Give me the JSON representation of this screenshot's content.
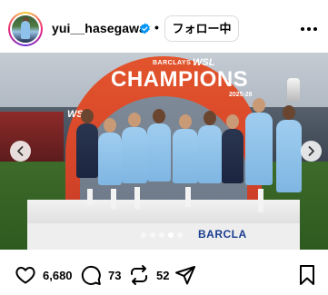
{
  "post": {
    "username": "yui__hasegawa",
    "verified": true,
    "separator": "•",
    "follow_label": "フォロー中",
    "image": {
      "signage_champions": "CHAMPIONS",
      "signage_barclays_top": "BARCLAYS",
      "signage_wsl": "WSL",
      "signage_season": "2025-26",
      "signage_barclays_bottom": "BARCLA",
      "carousel_total": 5,
      "carousel_active_index": 3
    },
    "stats": {
      "likes": "6,680",
      "comments": "73",
      "reposts": "52"
    }
  },
  "icons": {
    "verified": "verified-badge-icon",
    "more": "more-options-icon",
    "like": "heart-icon",
    "comment": "comment-bubble-icon",
    "repost": "repost-icon",
    "share": "paper-plane-icon",
    "save": "bookmark-icon",
    "prev": "chevron-left-icon",
    "next": "chevron-right-icon"
  },
  "colors": {
    "verified_blue": "#0095f6",
    "follow_border": "#dbdbdb",
    "arch_orange": "#e2542c",
    "kit_sky_blue": "#9fcdf0"
  }
}
